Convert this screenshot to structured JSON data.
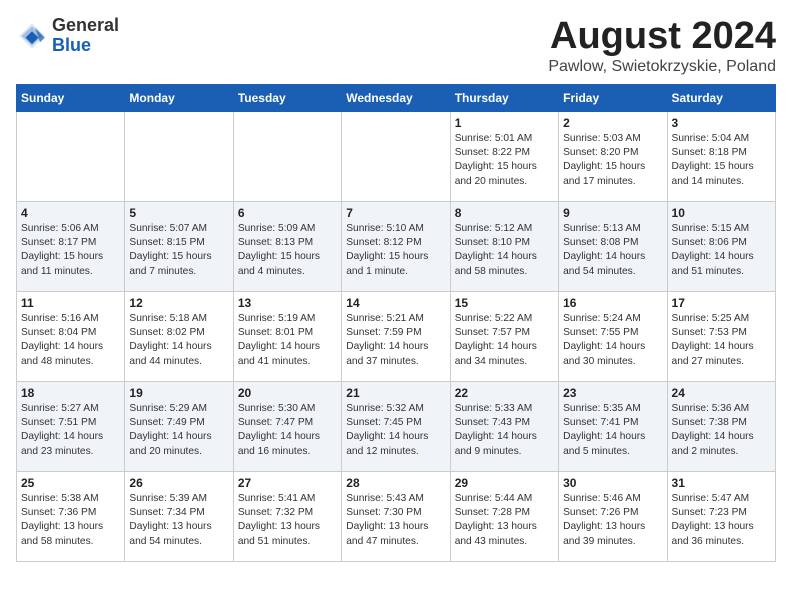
{
  "logo": {
    "general": "General",
    "blue": "Blue"
  },
  "title": {
    "month": "August 2024",
    "location": "Pawlow, Swietokrzyskie, Poland"
  },
  "weekdays": [
    "Sunday",
    "Monday",
    "Tuesday",
    "Wednesday",
    "Thursday",
    "Friday",
    "Saturday"
  ],
  "weeks": [
    [
      {
        "day": "",
        "info": ""
      },
      {
        "day": "",
        "info": ""
      },
      {
        "day": "",
        "info": ""
      },
      {
        "day": "",
        "info": ""
      },
      {
        "day": "1",
        "info": "Sunrise: 5:01 AM\nSunset: 8:22 PM\nDaylight: 15 hours\nand 20 minutes."
      },
      {
        "day": "2",
        "info": "Sunrise: 5:03 AM\nSunset: 8:20 PM\nDaylight: 15 hours\nand 17 minutes."
      },
      {
        "day": "3",
        "info": "Sunrise: 5:04 AM\nSunset: 8:18 PM\nDaylight: 15 hours\nand 14 minutes."
      }
    ],
    [
      {
        "day": "4",
        "info": "Sunrise: 5:06 AM\nSunset: 8:17 PM\nDaylight: 15 hours\nand 11 minutes."
      },
      {
        "day": "5",
        "info": "Sunrise: 5:07 AM\nSunset: 8:15 PM\nDaylight: 15 hours\nand 7 minutes."
      },
      {
        "day": "6",
        "info": "Sunrise: 5:09 AM\nSunset: 8:13 PM\nDaylight: 15 hours\nand 4 minutes."
      },
      {
        "day": "7",
        "info": "Sunrise: 5:10 AM\nSunset: 8:12 PM\nDaylight: 15 hours\nand 1 minute."
      },
      {
        "day": "8",
        "info": "Sunrise: 5:12 AM\nSunset: 8:10 PM\nDaylight: 14 hours\nand 58 minutes."
      },
      {
        "day": "9",
        "info": "Sunrise: 5:13 AM\nSunset: 8:08 PM\nDaylight: 14 hours\nand 54 minutes."
      },
      {
        "day": "10",
        "info": "Sunrise: 5:15 AM\nSunset: 8:06 PM\nDaylight: 14 hours\nand 51 minutes."
      }
    ],
    [
      {
        "day": "11",
        "info": "Sunrise: 5:16 AM\nSunset: 8:04 PM\nDaylight: 14 hours\nand 48 minutes."
      },
      {
        "day": "12",
        "info": "Sunrise: 5:18 AM\nSunset: 8:02 PM\nDaylight: 14 hours\nand 44 minutes."
      },
      {
        "day": "13",
        "info": "Sunrise: 5:19 AM\nSunset: 8:01 PM\nDaylight: 14 hours\nand 41 minutes."
      },
      {
        "day": "14",
        "info": "Sunrise: 5:21 AM\nSunset: 7:59 PM\nDaylight: 14 hours\nand 37 minutes."
      },
      {
        "day": "15",
        "info": "Sunrise: 5:22 AM\nSunset: 7:57 PM\nDaylight: 14 hours\nand 34 minutes."
      },
      {
        "day": "16",
        "info": "Sunrise: 5:24 AM\nSunset: 7:55 PM\nDaylight: 14 hours\nand 30 minutes."
      },
      {
        "day": "17",
        "info": "Sunrise: 5:25 AM\nSunset: 7:53 PM\nDaylight: 14 hours\nand 27 minutes."
      }
    ],
    [
      {
        "day": "18",
        "info": "Sunrise: 5:27 AM\nSunset: 7:51 PM\nDaylight: 14 hours\nand 23 minutes."
      },
      {
        "day": "19",
        "info": "Sunrise: 5:29 AM\nSunset: 7:49 PM\nDaylight: 14 hours\nand 20 minutes."
      },
      {
        "day": "20",
        "info": "Sunrise: 5:30 AM\nSunset: 7:47 PM\nDaylight: 14 hours\nand 16 minutes."
      },
      {
        "day": "21",
        "info": "Sunrise: 5:32 AM\nSunset: 7:45 PM\nDaylight: 14 hours\nand 12 minutes."
      },
      {
        "day": "22",
        "info": "Sunrise: 5:33 AM\nSunset: 7:43 PM\nDaylight: 14 hours\nand 9 minutes."
      },
      {
        "day": "23",
        "info": "Sunrise: 5:35 AM\nSunset: 7:41 PM\nDaylight: 14 hours\nand 5 minutes."
      },
      {
        "day": "24",
        "info": "Sunrise: 5:36 AM\nSunset: 7:38 PM\nDaylight: 14 hours\nand 2 minutes."
      }
    ],
    [
      {
        "day": "25",
        "info": "Sunrise: 5:38 AM\nSunset: 7:36 PM\nDaylight: 13 hours\nand 58 minutes."
      },
      {
        "day": "26",
        "info": "Sunrise: 5:39 AM\nSunset: 7:34 PM\nDaylight: 13 hours\nand 54 minutes."
      },
      {
        "day": "27",
        "info": "Sunrise: 5:41 AM\nSunset: 7:32 PM\nDaylight: 13 hours\nand 51 minutes."
      },
      {
        "day": "28",
        "info": "Sunrise: 5:43 AM\nSunset: 7:30 PM\nDaylight: 13 hours\nand 47 minutes."
      },
      {
        "day": "29",
        "info": "Sunrise: 5:44 AM\nSunset: 7:28 PM\nDaylight: 13 hours\nand 43 minutes."
      },
      {
        "day": "30",
        "info": "Sunrise: 5:46 AM\nSunset: 7:26 PM\nDaylight: 13 hours\nand 39 minutes."
      },
      {
        "day": "31",
        "info": "Sunrise: 5:47 AM\nSunset: 7:23 PM\nDaylight: 13 hours\nand 36 minutes."
      }
    ]
  ]
}
